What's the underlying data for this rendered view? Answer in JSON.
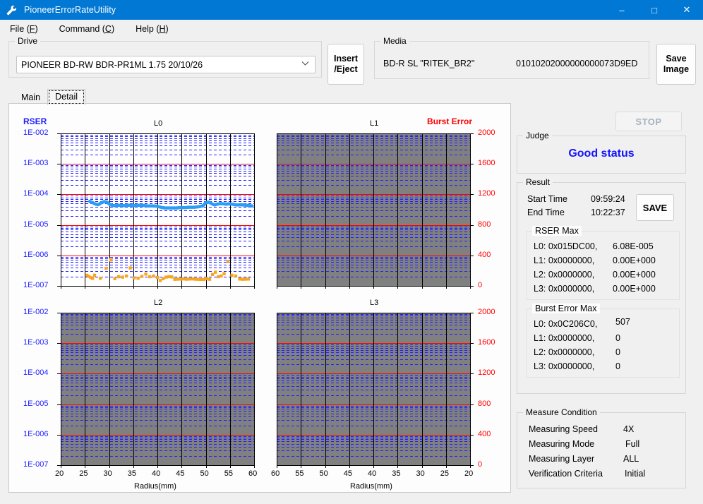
{
  "window": {
    "title": "PioneerErrorRateUtility",
    "icon": "wrench-icon",
    "minimize": "–",
    "maximize": "□",
    "close": "✕",
    "accent": "#0078d4"
  },
  "menubar": [
    {
      "label": "File",
      "accel": "F"
    },
    {
      "label": "Command",
      "accel": "C"
    },
    {
      "label": "Help",
      "accel": "H"
    }
  ],
  "drive": {
    "group_label": "Drive",
    "selected": "PIONEER BD-RW  BDR-PR1ML 1.75 20/10/26",
    "chevron": "⌄"
  },
  "buttons": {
    "insert_eject_line1": "Insert",
    "insert_eject_line2": "/Eject",
    "save_image_line1": "Save",
    "save_image_line2": "Image",
    "stop": "STOP",
    "save": "SAVE"
  },
  "media": {
    "group_label": "Media",
    "type": "BD-R SL \"RITEK_BR2\"",
    "id": "01010202000000000073D9ED"
  },
  "tabs": [
    {
      "label": "Main",
      "active": false
    },
    {
      "label": "Detail",
      "active": true
    }
  ],
  "judge": {
    "group_label": "Judge",
    "value": "Good status",
    "color": "#1414ff"
  },
  "result": {
    "group_label": "Result",
    "start_time_label": "Start Time",
    "start_time_value": "09:59:24",
    "end_time_label": "End Time",
    "end_time_value": "10:22:37",
    "rser_max": {
      "label": "RSER Max",
      "rows": [
        {
          "layer": "L0: 0x015DC00,",
          "value": "6.08E-005"
        },
        {
          "layer": "L1: 0x0000000,",
          "value": "0.00E+000"
        },
        {
          "layer": "L2: 0x0000000,",
          "value": "0.00E+000"
        },
        {
          "layer": "L3: 0x0000000,",
          "value": "0.00E+000"
        }
      ]
    },
    "burst_error_max": {
      "label": "Burst Error Max",
      "rows": [
        {
          "layer": "L0: 0x0C206C0,",
          "value": "507"
        },
        {
          "layer": "L1: 0x0000000,",
          "value": "0"
        },
        {
          "layer": "L2: 0x0000000,",
          "value": "0"
        },
        {
          "layer": "L3: 0x0000000,",
          "value": "0"
        }
      ]
    }
  },
  "measure_condition": {
    "group_label": "Measure Condition",
    "rows": [
      {
        "name": "Measuring Speed",
        "value": "4X"
      },
      {
        "name": "Measuring Mode",
        "value": "Full"
      },
      {
        "name": "Measuring Layer",
        "value": "ALL"
      },
      {
        "name": "Verification Criteria",
        "value": "Initial"
      }
    ]
  },
  "chart_data": {
    "type": "scatter",
    "title": "RSER / Burst Error vs Radius — Layers L0-L3",
    "left_axis_title": "RSER",
    "left_axis_color": "#2020ff",
    "right_axis_title": "Burst Error",
    "right_axis_color": "#ff0000",
    "xlabel": "Radius(mm)",
    "y_left_ticks": [
      "1E-002",
      "1E-003",
      "1E-004",
      "1E-005",
      "1E-006",
      "1E-007"
    ],
    "y_left_range": [
      1e-07,
      0.01
    ],
    "y_left_scale": "log",
    "y_right_ticks": [
      "2000",
      "1600",
      "1200",
      "800",
      "400",
      "0"
    ],
    "y_right_range": [
      0,
      2000
    ],
    "y_right_scale": "linear",
    "x_ticks_forward": [
      "20",
      "25",
      "30",
      "35",
      "40",
      "45",
      "50",
      "55",
      "60"
    ],
    "x_ticks_reverse": [
      "60",
      "55",
      "50",
      "45",
      "40",
      "35",
      "30",
      "25",
      "20"
    ],
    "xlim": [
      20,
      60
    ],
    "grid": true,
    "gridline_minor_color": "#2020ff",
    "gridline_decade_color": "#ff0000",
    "gridline_vertical_color": "#000000",
    "panels": [
      {
        "name": "L0",
        "enabled": true,
        "background": "#ffffff",
        "x_direction": "forward",
        "series": [
          {
            "name": "RSER",
            "color": "#2a9df4",
            "x": [
              26.0,
              26.6,
              27.2,
              27.8,
              28.4,
              29.0,
              29.6,
              30.2,
              30.8,
              31.4,
              32.0,
              32.6,
              33.2,
              33.8,
              34.4,
              35.0,
              35.6,
              36.2,
              36.8,
              37.4,
              38.0,
              38.6,
              39.2,
              39.8,
              40.4,
              41.0,
              41.6,
              42.2,
              42.8,
              43.4,
              44.0,
              44.6,
              45.2,
              45.8,
              46.4,
              47.0,
              47.6,
              48.2,
              48.8,
              49.4,
              50.0,
              50.6,
              51.2,
              51.8,
              52.4,
              53.0,
              53.6,
              54.2,
              54.8,
              55.4,
              56.0,
              56.6,
              57.2,
              57.8,
              58.4,
              59.0,
              59.6
            ],
            "y": [
              5.9e-05,
              5.4e-05,
              4.8e-05,
              4.6e-05,
              5.3e-05,
              5.8e-05,
              5.6e-05,
              4.6e-05,
              4.3e-05,
              4.3e-05,
              4.4e-05,
              4.3e-05,
              4.3e-05,
              4.4e-05,
              4.4e-05,
              4.3e-05,
              4.3e-05,
              4.4e-05,
              4.4e-05,
              4.3e-05,
              4.2e-05,
              4.2e-05,
              4.2e-05,
              4.1e-05,
              3.9e-05,
              3.7e-05,
              3.6e-05,
              3.6e-05,
              3.6e-05,
              3.6e-05,
              3.6e-05,
              3.7e-05,
              3.7e-05,
              3.7e-05,
              3.8e-05,
              3.8e-05,
              3.8e-05,
              3.9e-05,
              4e-05,
              4.2e-05,
              5.3e-05,
              5.6e-05,
              5e-05,
              4.5e-05,
              4.8e-05,
              5e-05,
              4.9e-05,
              4.8e-05,
              4.9e-05,
              4.8e-05,
              4.6e-05,
              4.5e-05,
              4.6e-05,
              4.5e-05,
              4.4e-05,
              4.3e-05,
              4.2e-05
            ]
          },
          {
            "name": "Burst Error",
            "color": "#f5a623",
            "x": [
              25.4,
              25.8,
              26.2,
              26.6,
              27.0,
              28.2,
              29.4,
              30.4,
              31.2,
              32.0,
              32.8,
              33.6,
              34.4,
              35.2,
              36.0,
              36.8,
              37.6,
              38.4,
              39.2,
              40.0,
              40.6,
              41.2,
              41.8,
              42.4,
              43.0,
              43.6,
              44.2,
              44.8,
              45.4,
              46.0,
              46.6,
              47.2,
              47.8,
              48.4,
              49.0,
              49.6,
              50.2,
              50.8,
              51.4,
              52.0,
              52.6,
              53.2,
              53.8,
              54.6,
              55.4,
              56.2,
              57.0,
              57.6,
              58.2,
              58.8
            ],
            "y": [
              140,
              125,
              110,
              98,
              140,
              100,
              230,
              340,
              95,
              120,
              115,
              130,
              235,
              105,
              100,
              125,
              155,
              120,
              130,
              110,
              70,
              95,
              115,
              120,
              118,
              86,
              88,
              90,
              92,
              88,
              90,
              92,
              88,
              86,
              84,
              84,
              96,
              86,
              150,
              180,
              120,
              130,
              160,
              320,
              140,
              130,
              90,
              86,
              88,
              90
            ]
          }
        ]
      },
      {
        "name": "L1",
        "enabled": false,
        "background": "#808080",
        "x_direction": "reverse",
        "series": []
      },
      {
        "name": "L2",
        "enabled": false,
        "background": "#808080",
        "x_direction": "forward",
        "series": []
      },
      {
        "name": "L3",
        "enabled": false,
        "background": "#808080",
        "x_direction": "reverse",
        "series": []
      }
    ]
  }
}
